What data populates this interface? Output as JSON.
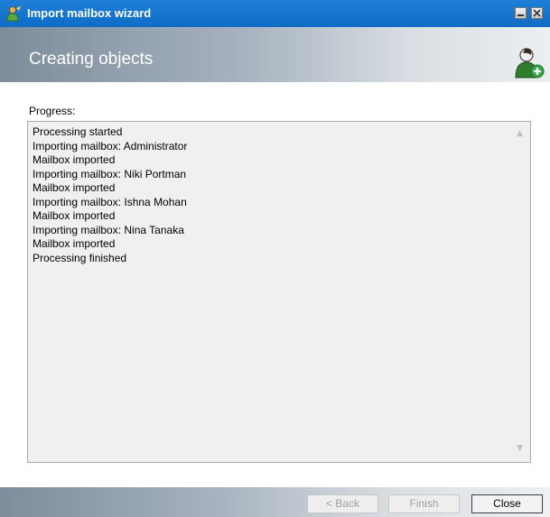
{
  "window": {
    "title": "Import mailbox wizard",
    "icon": "user-wizard-icon",
    "controls": [
      "minimize-icon",
      "close-icon"
    ]
  },
  "header": {
    "title": "Creating objects",
    "icon": "user-add-icon"
  },
  "progress": {
    "label": "Progress:",
    "lines": [
      "Processing started",
      "Importing mailbox: Administrator",
      "Mailbox imported",
      "Importing mailbox: Niki Portman",
      "Mailbox imported",
      "Importing mailbox: Ishna Mohan",
      "Mailbox imported",
      "Importing mailbox: Nina Tanaka",
      "Mailbox imported",
      "Processing finished"
    ]
  },
  "buttons": {
    "back": "< Back",
    "finish": "Finish",
    "close": "Close"
  },
  "colors": {
    "titlebar": "#1276cf",
    "log_background": "#f0f0f0"
  }
}
